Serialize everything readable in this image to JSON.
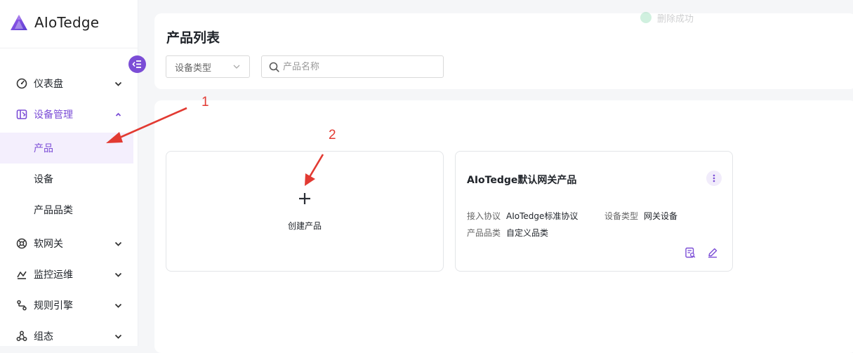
{
  "app": {
    "name": "AIoTedge",
    "accent": "#7b4dd6",
    "logo_icon": "aiotedge-logo-icon"
  },
  "sidebar": {
    "collapse_icon": "menu-collapse-icon",
    "menu": [
      {
        "key": "dashboard",
        "label": "仪表盘",
        "icon": "dashboard-icon",
        "expanded": false
      },
      {
        "key": "device-mgmt",
        "label": "设备管理",
        "icon": "device-management-icon",
        "expanded": true
      },
      {
        "key": "soft-gateway",
        "label": "软网关",
        "icon": "soft-gateway-icon",
        "expanded": false
      },
      {
        "key": "monitoring",
        "label": "监控运维",
        "icon": "monitoring-icon",
        "expanded": false
      },
      {
        "key": "rule-engine",
        "label": "规则引擎",
        "icon": "rule-engine-icon",
        "expanded": false
      },
      {
        "key": "configuration",
        "label": "组态",
        "icon": "configuration-icon",
        "expanded": false
      }
    ],
    "submenu": [
      {
        "label": "产品",
        "selected": true
      },
      {
        "label": "设备",
        "selected": false
      },
      {
        "label": "产品品类",
        "selected": false
      }
    ]
  },
  "header": {
    "title": "产品列表",
    "device_type_select": {
      "value": "设备类型"
    },
    "search": {
      "placeholder": "产品名称",
      "value": ""
    },
    "toast": {
      "text": "删除成功",
      "color": "#2fbf71"
    }
  },
  "create_card": {
    "label": "创建产品"
  },
  "products": [
    {
      "name": "AIoTedge默认网关产品",
      "fields": [
        {
          "key": "接入协议",
          "value": "AIoTedge标准协议"
        },
        {
          "key": "设备类型",
          "value": "网关设备"
        },
        {
          "key": "产品品类",
          "value": "自定义品类"
        }
      ]
    }
  ],
  "annotations": {
    "color": "#e23a32",
    "labels": [
      "1",
      "2"
    ]
  }
}
